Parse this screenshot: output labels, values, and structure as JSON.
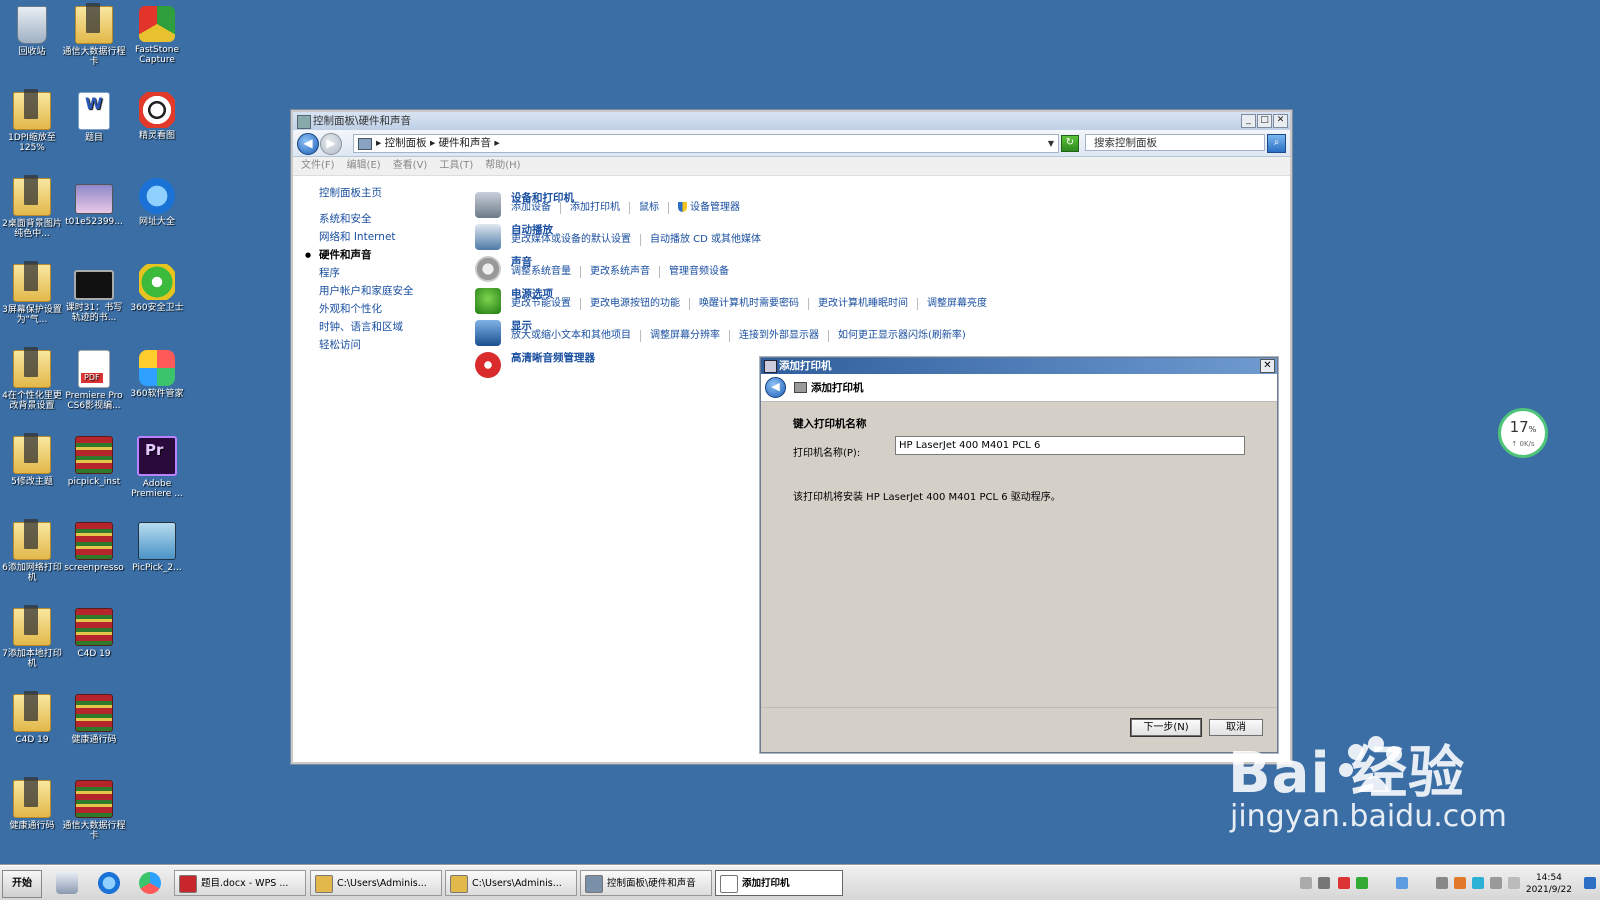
{
  "desktop": {
    "icons": [
      {
        "label": "回收站",
        "icon": "recycle-bin-icon"
      },
      {
        "label": "通信大数据行程卡",
        "icon": "folder-icon"
      },
      {
        "label": "FastStone Capture",
        "icon": "faststone-icon"
      },
      {
        "label": "1DPI缩放至125%",
        "icon": "folder-icon"
      },
      {
        "label": "题目",
        "icon": "word-doc-icon"
      },
      {
        "label": "精灵看图",
        "icon": "viewer-icon"
      },
      {
        "label": "2桌面背景图片纯色中...",
        "icon": "folder-icon"
      },
      {
        "label": "t01e52399...",
        "icon": "image-icon"
      },
      {
        "label": "网址大全",
        "icon": "ie-icon"
      },
      {
        "label": "3屏幕保护设置为\"气...",
        "icon": "folder-icon"
      },
      {
        "label": "课时31：书写轨迹的书...",
        "icon": "video-icon"
      },
      {
        "label": "360安全卫士",
        "icon": "360-safe-icon"
      },
      {
        "label": "4在个性化里更改背景设置",
        "icon": "folder-icon"
      },
      {
        "label": "Premiere Pro CS6影视编...",
        "icon": "pdf-icon"
      },
      {
        "label": "360软件管家",
        "icon": "360-manager-icon"
      },
      {
        "label": "5修改主题",
        "icon": "folder-icon"
      },
      {
        "label": "picpick_inst",
        "icon": "winrar-icon"
      },
      {
        "label": "Adobe Premiere ...",
        "icon": "premiere-icon"
      },
      {
        "label": "6添加网络打印机",
        "icon": "folder-icon"
      },
      {
        "label": "screenpresso",
        "icon": "winrar-icon"
      },
      {
        "label": "PicPick_2...",
        "icon": "picpick-icon"
      },
      {
        "label": "7添加本地打印机",
        "icon": "folder-icon"
      },
      {
        "label": "C4D 19",
        "icon": "winrar-icon"
      },
      {
        "label": "C4D 19",
        "icon": "folder-icon"
      },
      {
        "label": "健康通行码",
        "icon": "winrar-icon"
      },
      {
        "label": "健康通行码",
        "icon": "folder-icon"
      },
      {
        "label": "通信大数据行程卡",
        "icon": "winrar-icon"
      }
    ]
  },
  "explorer": {
    "title": "控制面板\\硬件和声音",
    "address": "▸ 控制面板 ▸ 硬件和声音 ▸",
    "search_placeholder": "搜索控制面板",
    "menu": [
      "文件(F)",
      "编辑(E)",
      "查看(V)",
      "工具(T)",
      "帮助(H)"
    ],
    "nav": [
      "控制面板主页",
      "系统和安全",
      "网络和 Internet",
      "硬件和声音",
      "程序",
      "用户帐户和家庭安全",
      "外观和个性化",
      "时钟、语言和区域",
      "轻松访问"
    ],
    "nav_active_index": 3,
    "categories": [
      {
        "title": "设备和打印机",
        "icon": "printer-icon",
        "links": [
          "添加设备",
          "添加打印机",
          "鼠标",
          "设备管理器"
        ]
      },
      {
        "title": "自动播放",
        "icon": "autoplay-icon",
        "links": [
          "更改媒体或设备的默认设置",
          "自动播放 CD 或其他媒体"
        ]
      },
      {
        "title": "声音",
        "icon": "speaker-icon",
        "links": [
          "调整系统音量",
          "更改系统声音",
          "管理音频设备"
        ]
      },
      {
        "title": "电源选项",
        "icon": "power-icon",
        "links": [
          "更改节能设置",
          "更改电源按钮的功能",
          "唤醒计算机时需要密码",
          "更改计算机睡眠时间",
          "调整屏幕亮度"
        ]
      },
      {
        "title": "显示",
        "icon": "display-icon",
        "links": [
          "放大或缩小文本和其他项目",
          "调整屏幕分辨率",
          "连接到外部显示器",
          "如何更正显示器闪烁(刷新率)"
        ]
      },
      {
        "title": "高清晰音频管理器",
        "icon": "hd-audio-icon",
        "links": []
      }
    ]
  },
  "dialog": {
    "title": "添加打印机",
    "header": "添加打印机",
    "section": "键入打印机名称",
    "label": "打印机名称(P):",
    "printer_name": "HP LaserJet 400 M401 PCL 6",
    "note": "该打印机将安装 HP LaserJet 400 M401 PCL 6 驱动程序。",
    "next": "下一步(N)",
    "cancel": "取消"
  },
  "net_widget": {
    "percent": "17",
    "unit": "%",
    "speed": "↑ 0K/s"
  },
  "watermark": {
    "brand": "Bai  经验",
    "domain": "jingyan.baidu.com"
  },
  "taskbar": {
    "start": "开始",
    "tasks": [
      {
        "label": "题目.docx - WPS ...",
        "icon": "wps-icon"
      },
      {
        "label": "C:\\Users\\Adminis...",
        "icon": "folder-icon"
      },
      {
        "label": "C:\\Users\\Adminis...",
        "icon": "folder-icon"
      },
      {
        "label": "控制面板\\硬件和声音",
        "icon": "control-panel-icon"
      },
      {
        "label": "添加打印机",
        "icon": "printer-doc-icon"
      }
    ],
    "active_task_index": 4,
    "time": "14:54",
    "date": "2021/9/22"
  }
}
